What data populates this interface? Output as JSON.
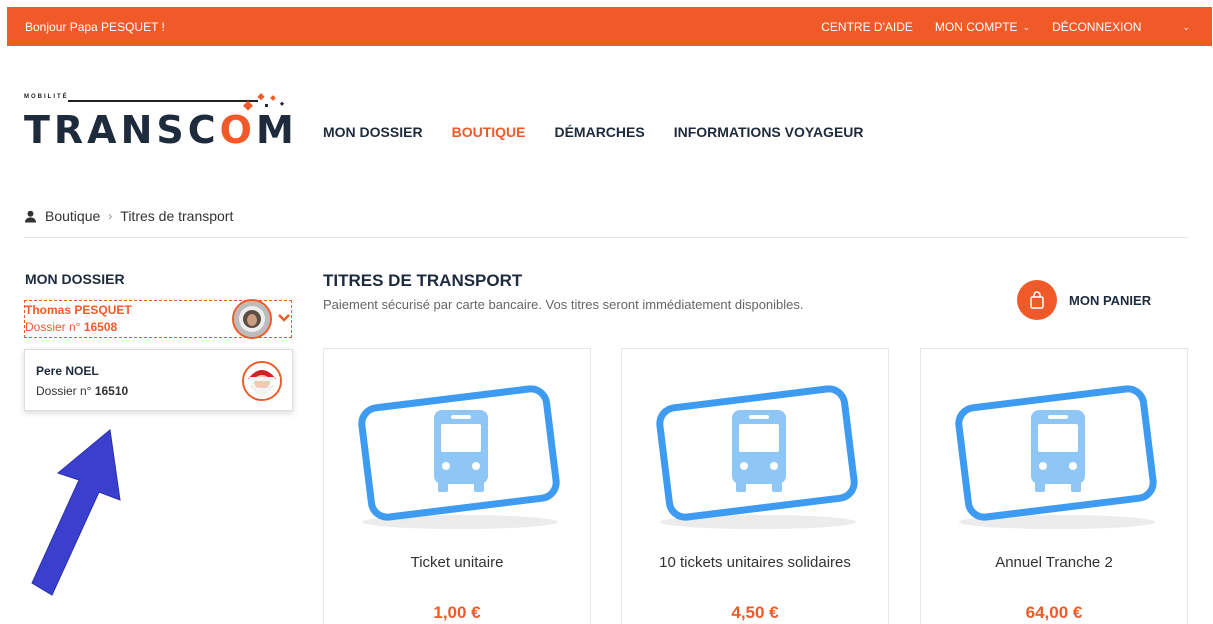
{
  "topbar": {
    "greeting": "Bonjour Papa PESQUET !",
    "help": "CENTRE D'AIDE",
    "account": "MON COMPTE",
    "logout": "DÉCONNEXION",
    "chevron": "⌄"
  },
  "logo": {
    "small": "MOBILITÉ",
    "word_a": "TRANSC",
    "word_o": "O",
    "word_b": "M"
  },
  "nav": {
    "items": [
      "MON DOSSIER",
      "BOUTIQUE",
      "DÉMARCHES",
      "INFORMATIONS VOYAGEUR"
    ],
    "active": "BOUTIQUE"
  },
  "breadcrumb": {
    "root": "Boutique",
    "separator": "›",
    "current": "Titres de transport"
  },
  "sidebar": {
    "title": "MON DOSSIER",
    "current": {
      "name": "Thomas PESQUET",
      "dossier_prefix": "Dossier n°",
      "dossier_number": "16508"
    },
    "options": [
      {
        "name": "Pere NOEL",
        "dossier_prefix": "Dossier n°",
        "dossier_number": "16510"
      }
    ]
  },
  "main": {
    "title": "TITRES DE TRANSPORT",
    "subtitle": "Paiement sécurisé par carte bancaire. Vos titres seront immédiatement disponibles.",
    "cart_label": "MON PANIER",
    "products": [
      {
        "title": "Ticket unitaire",
        "price": "1,00 €"
      },
      {
        "title": "10 tickets unitaires solidaires",
        "price": "4,50 €"
      },
      {
        "title": "Annuel Tranche 2",
        "price": "64,00 €"
      }
    ]
  },
  "colors": {
    "accent": "#f05a28",
    "navy": "#1d2b3c",
    "ticket_blue": "#3d9bf2",
    "bus_light_blue": "#8ec6f5",
    "annotation_arrow": "#3b3fce"
  },
  "icons": {
    "user": "user-icon",
    "cart": "shopping-bag-icon",
    "bus": "bus-icon",
    "dropdown": "chevron-down-icon",
    "flag": "french-flag-icon"
  }
}
